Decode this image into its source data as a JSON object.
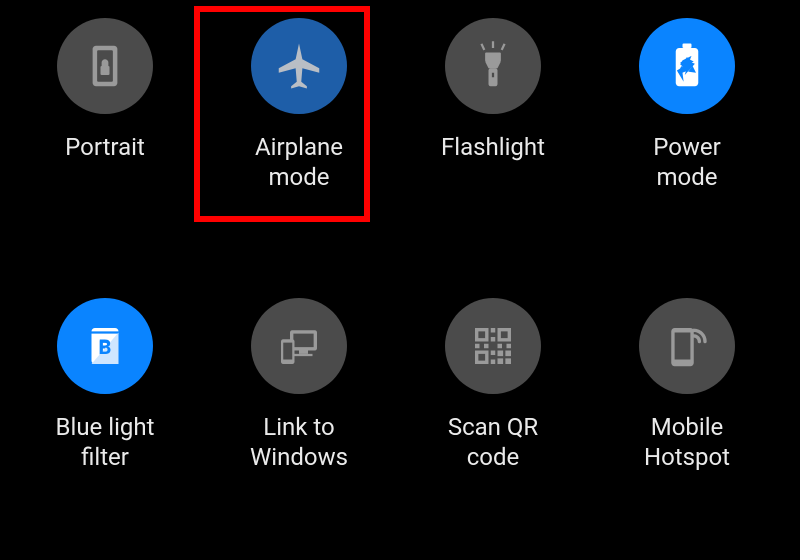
{
  "colors": {
    "off_circle": "#4b4b4b",
    "on_blue": "#1e5ea8",
    "on_bright": "#0a84ff",
    "highlight": "#ff0000"
  },
  "highlight": {
    "target_index": 1
  },
  "tiles": [
    {
      "icon": "portrait-lock-icon",
      "label": "Portrait",
      "active": false,
      "variant": "off"
    },
    {
      "icon": "airplane-icon",
      "label": "Airplane\nmode",
      "active": true,
      "variant": "blue"
    },
    {
      "icon": "flashlight-icon",
      "label": "Flashlight",
      "active": false,
      "variant": "off"
    },
    {
      "icon": "power-mode-icon",
      "label": "Power\nmode",
      "active": true,
      "variant": "bright"
    },
    {
      "icon": "blue-light-filter-icon",
      "label": "Blue light\nfilter",
      "active": true,
      "variant": "bright"
    },
    {
      "icon": "link-to-windows-icon",
      "label": "Link to\nWindows",
      "active": false,
      "variant": "off"
    },
    {
      "icon": "qr-code-icon",
      "label": "Scan QR\ncode",
      "active": false,
      "variant": "off"
    },
    {
      "icon": "mobile-hotspot-icon",
      "label": "Mobile\nHotspot",
      "active": false,
      "variant": "off"
    }
  ]
}
